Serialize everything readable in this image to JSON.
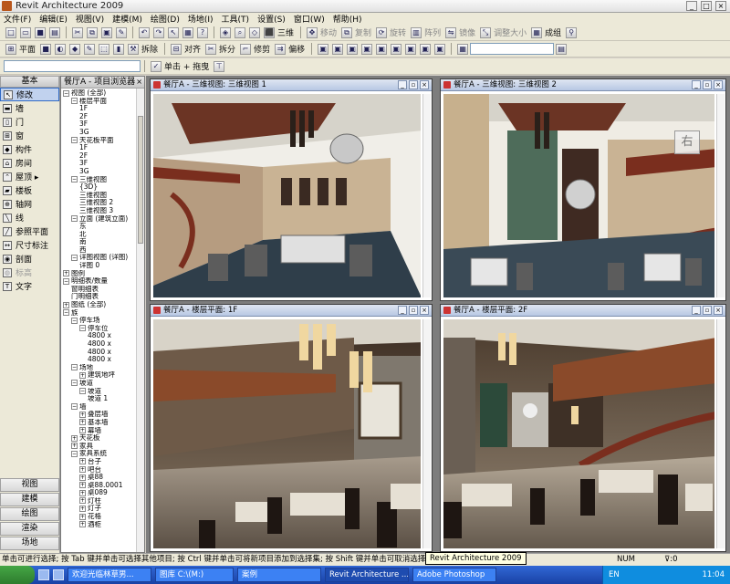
{
  "window": {
    "title": "Revit Architecture 2009"
  },
  "menu": [
    "文件(F)",
    "编辑(E)",
    "视图(V)",
    "建模(M)",
    "绘图(D)",
    "场地(I)",
    "工具(T)",
    "设置(S)",
    "窗口(W)",
    "帮助(H)"
  ],
  "toolbar1": {
    "view3d_label": "三维",
    "move": "移动",
    "copy": "复制",
    "rotate": "旋转",
    "array": "阵列",
    "mirror": "镜像",
    "resize": "调整大小",
    "group": "成组"
  },
  "toolbar2": {
    "plan": "平面",
    "split_wall": "拆除",
    "align": "对齐",
    "split": "拆分",
    "trim": "修剪",
    "offset": "偏移"
  },
  "toolbar3": {
    "select_mode": "单击 + 拖曳"
  },
  "design_bar": {
    "header": "基本",
    "tools": [
      {
        "label": "修改",
        "icon": "arrow-icon",
        "active": true
      },
      {
        "label": "墙",
        "icon": "wall-icon"
      },
      {
        "label": "门",
        "icon": "door-icon"
      },
      {
        "label": "窗",
        "icon": "window-icon"
      },
      {
        "label": "构件",
        "icon": "component-icon"
      },
      {
        "label": "房间",
        "icon": "room-icon"
      },
      {
        "label": "屋顶 ▸",
        "icon": "roof-icon"
      },
      {
        "label": "楼板",
        "icon": "floor-icon"
      },
      {
        "label": "轴网",
        "icon": "grid-icon"
      },
      {
        "label": "线",
        "icon": "line-icon"
      },
      {
        "label": "参照平面",
        "icon": "ref-plane-icon"
      },
      {
        "label": "尺寸标注",
        "icon": "dimension-icon"
      },
      {
        "label": "剖面",
        "icon": "section-icon"
      },
      {
        "label": "标高",
        "icon": "level-icon",
        "dim": true
      },
      {
        "label": "文字",
        "icon": "text-icon"
      }
    ],
    "tabs": [
      "视图",
      "建模",
      "绘图",
      "渲染",
      "场地"
    ]
  },
  "project_browser": {
    "title": "餐厅A - 项目浏览器",
    "nodes": [
      {
        "indent": 0,
        "exp": "−",
        "label": "视图 (全部)"
      },
      {
        "indent": 1,
        "exp": "−",
        "label": "楼层平面"
      },
      {
        "indent": 2,
        "label": "1F"
      },
      {
        "indent": 2,
        "label": "2F"
      },
      {
        "indent": 2,
        "label": "3F"
      },
      {
        "indent": 2,
        "label": "3G"
      },
      {
        "indent": 1,
        "exp": "−",
        "label": "天花板平面"
      },
      {
        "indent": 2,
        "label": "1F"
      },
      {
        "indent": 2,
        "label": "2F"
      },
      {
        "indent": 2,
        "label": "3F"
      },
      {
        "indent": 2,
        "label": "3G"
      },
      {
        "indent": 1,
        "exp": "−",
        "label": "三维视图"
      },
      {
        "indent": 2,
        "label": "{3D}"
      },
      {
        "indent": 2,
        "label": "三维视图"
      },
      {
        "indent": 2,
        "label": "三维视图 2"
      },
      {
        "indent": 2,
        "label": "三维视图 3"
      },
      {
        "indent": 1,
        "exp": "−",
        "label": "立面 (建筑立面)"
      },
      {
        "indent": 2,
        "label": "东"
      },
      {
        "indent": 2,
        "label": "北"
      },
      {
        "indent": 2,
        "label": "南"
      },
      {
        "indent": 2,
        "label": "西"
      },
      {
        "indent": 1,
        "exp": "−",
        "label": "详图视图 (详图)"
      },
      {
        "indent": 2,
        "label": "详图 0"
      },
      {
        "indent": 0,
        "exp": "+",
        "label": "图例"
      },
      {
        "indent": 0,
        "exp": "−",
        "label": "明细表/数量"
      },
      {
        "indent": 1,
        "label": "窗明细表"
      },
      {
        "indent": 1,
        "label": "门明细表"
      },
      {
        "indent": 0,
        "exp": "+",
        "label": "图纸 (全部)"
      },
      {
        "indent": 0,
        "exp": "−",
        "label": "族"
      },
      {
        "indent": 1,
        "exp": "−",
        "label": "停车场"
      },
      {
        "indent": 2,
        "exp": "−",
        "label": "停车位"
      },
      {
        "indent": 3,
        "label": "4800 x"
      },
      {
        "indent": 3,
        "label": "4800 x"
      },
      {
        "indent": 3,
        "label": "4800 x"
      },
      {
        "indent": 3,
        "label": "4800 x"
      },
      {
        "indent": 1,
        "exp": "−",
        "label": "场地"
      },
      {
        "indent": 2,
        "exp": "+",
        "label": "建筑地坪"
      },
      {
        "indent": 1,
        "exp": "−",
        "label": "坡道"
      },
      {
        "indent": 2,
        "exp": "−",
        "label": "坡道"
      },
      {
        "indent": 3,
        "label": "坡道 1"
      },
      {
        "indent": 1,
        "exp": "−",
        "label": "墙"
      },
      {
        "indent": 2,
        "exp": "+",
        "label": "叠层墙"
      },
      {
        "indent": 2,
        "exp": "+",
        "label": "基本墙"
      },
      {
        "indent": 2,
        "exp": "+",
        "label": "幕墙"
      },
      {
        "indent": 1,
        "exp": "+",
        "label": "天花板"
      },
      {
        "indent": 1,
        "exp": "+",
        "label": "家具"
      },
      {
        "indent": 1,
        "exp": "−",
        "label": "家具系统"
      },
      {
        "indent": 2,
        "exp": "+",
        "label": "台子"
      },
      {
        "indent": 2,
        "exp": "+",
        "label": "吧台"
      },
      {
        "indent": 2,
        "exp": "+",
        "label": "桌88"
      },
      {
        "indent": 2,
        "exp": "+",
        "label": "桌88.0001"
      },
      {
        "indent": 2,
        "exp": "+",
        "label": "桌089"
      },
      {
        "indent": 2,
        "exp": "+",
        "label": "灯柱"
      },
      {
        "indent": 2,
        "exp": "+",
        "label": "灯子"
      },
      {
        "indent": 2,
        "exp": "+",
        "label": "花格"
      },
      {
        "indent": 2,
        "exp": "+",
        "label": "酒柜"
      }
    ]
  },
  "views": [
    {
      "title": "餐厅A - 三维视图: 三维视图 1",
      "kind": "model-a"
    },
    {
      "title": "餐厅A - 三维视图: 三维视图 2",
      "kind": "model-b",
      "cube_label": "右"
    },
    {
      "title": "餐厅A - 楼层平面: 1F",
      "kind": "render-a"
    },
    {
      "title": "餐厅A - 楼层平面: 2F",
      "kind": "render-b"
    }
  ],
  "status": {
    "text": "单击可进行选择; 按 Tab 键并单击可选择其他项目; 按 Ctrl 键并单击可将新项目添加到选择集; 按 Shift 键并单击可取消选择。",
    "num": "NUM",
    "filter": "0",
    "tooltip": "Revit Architecture 2009"
  },
  "taskbar": {
    "tasks": [
      "欢迎光临林草男...",
      "图库 C:\\(M:)",
      "案例",
      "Revit Architecture ...",
      "Adobe Photoshop"
    ],
    "active_index": 3,
    "lang": "EN",
    "clock": "11:04"
  }
}
